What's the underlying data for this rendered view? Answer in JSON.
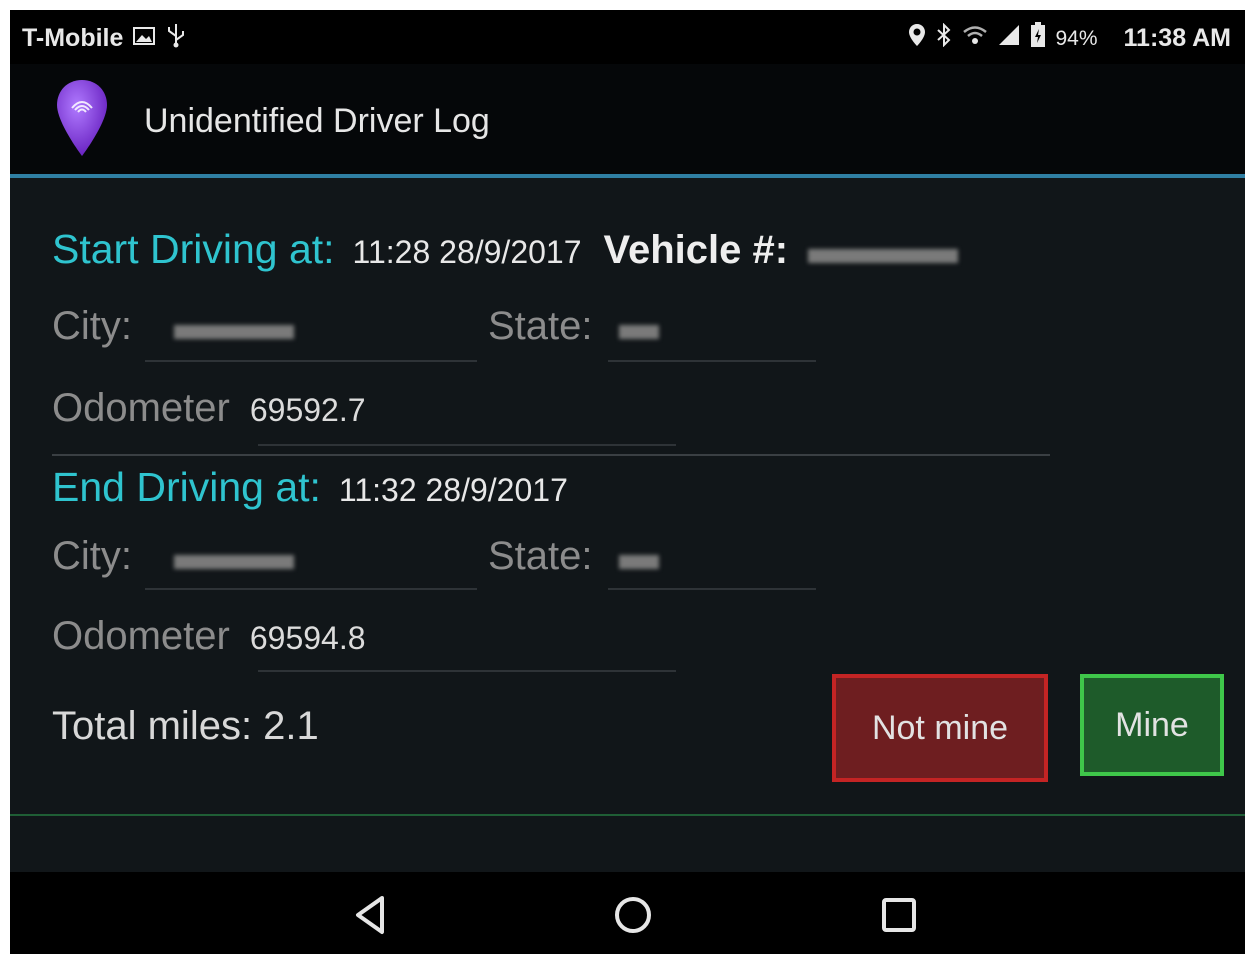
{
  "status_bar": {
    "carrier": "T-Mobile",
    "battery_percent": "94%",
    "time": "11:38 AM",
    "left_icons": [
      "image-icon",
      "usb-icon"
    ],
    "right_icons": [
      "location-icon",
      "bluetooth-icon",
      "wifi-icon",
      "signal-icon",
      "battery-icon"
    ]
  },
  "app_bar": {
    "title": "Unidentified Driver Log",
    "icon": "location-pin-icon",
    "icon_color": "#8b3fd6"
  },
  "start": {
    "label": "Start Driving at:",
    "datetime": "11:28 28/9/2017",
    "vehicle_label": "Vehicle #:",
    "city_label": "City:",
    "state_label": "State:",
    "odometer_label": "Odometer",
    "odometer_value": "69592.7"
  },
  "end": {
    "label": "End Driving at:",
    "datetime": "11:32 28/9/2017",
    "city_label": "City:",
    "state_label": "State:",
    "odometer_label": "Odometer",
    "odometer_value": "69594.8"
  },
  "total_miles": "Total miles: 2.1",
  "buttons": {
    "not_mine": "Not mine",
    "mine": "Mine"
  },
  "colors": {
    "accent": "#2fc4cf",
    "not_mine_border": "#c42424",
    "mine_border": "#3fc74a",
    "divider": "#2f7fa3"
  },
  "nav_bar": {
    "icons": [
      "back-icon",
      "home-icon",
      "recents-icon"
    ]
  }
}
